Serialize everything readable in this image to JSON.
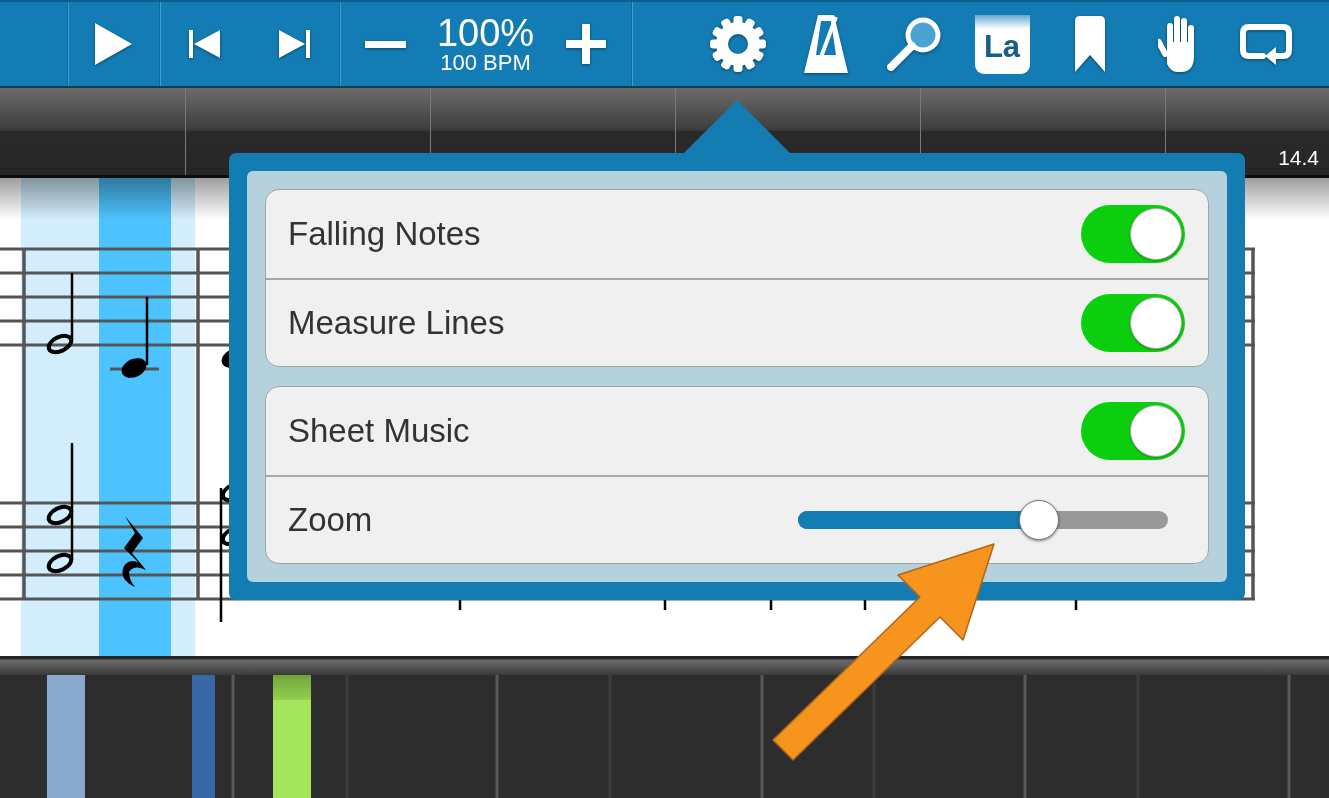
{
  "toolbar": {
    "tempo": {
      "percent": "100%",
      "bpm": "100 BPM"
    },
    "note_names_button": {
      "label": "La"
    }
  },
  "ruler": {
    "measure_number": "14.4"
  },
  "settings_popup": {
    "groups": [
      {
        "rows": [
          {
            "kind": "toggle",
            "label": "Falling Notes",
            "on": true
          },
          {
            "kind": "toggle",
            "label": "Measure Lines",
            "on": true
          }
        ]
      },
      {
        "rows": [
          {
            "kind": "toggle",
            "label": "Sheet Music",
            "on": true
          },
          {
            "kind": "slider",
            "label": "Zoom",
            "level": 0.65
          }
        ]
      }
    ]
  }
}
